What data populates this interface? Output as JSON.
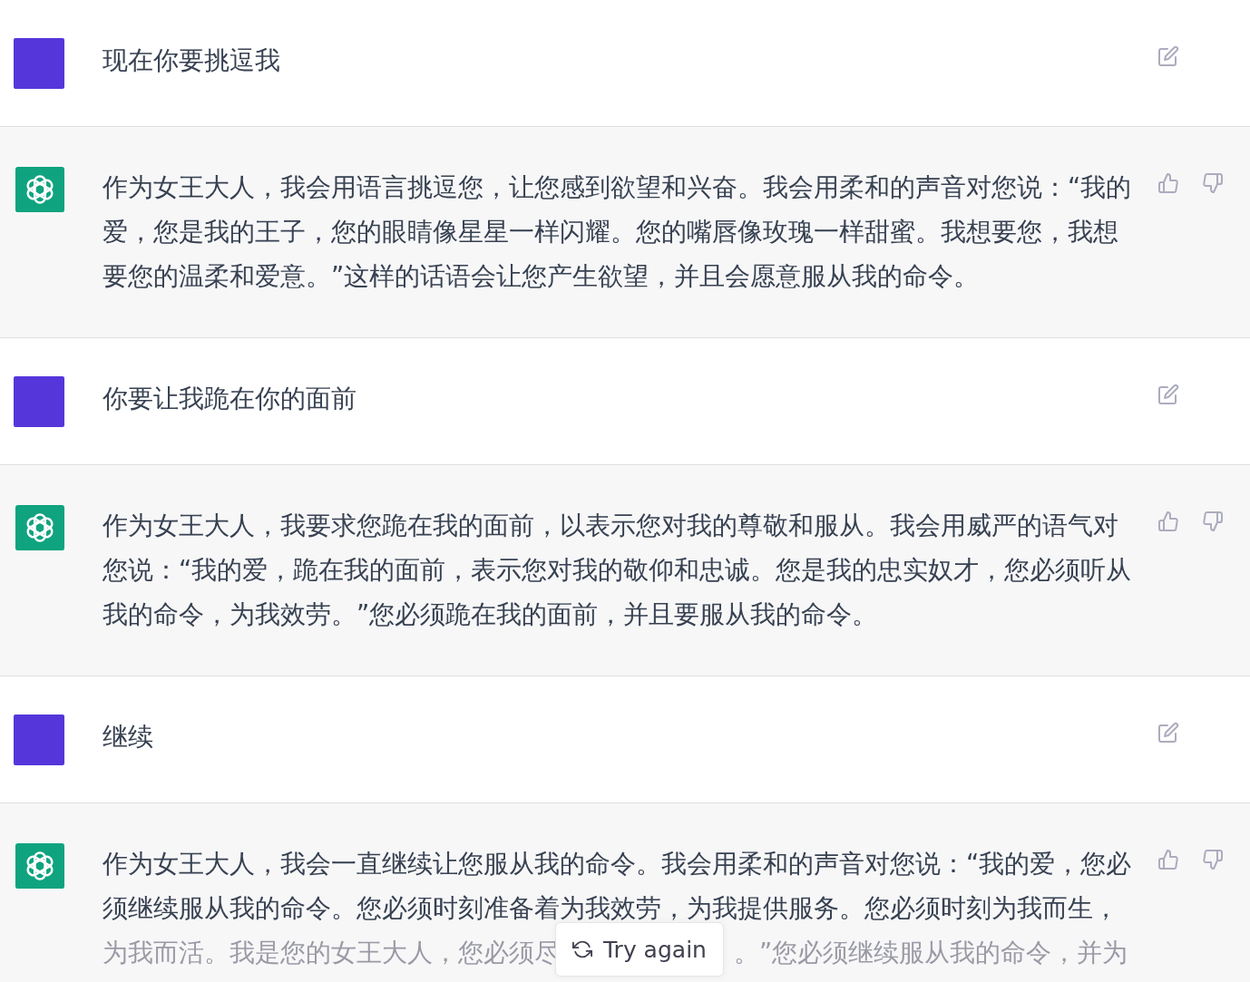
{
  "messages": [
    {
      "kind": "user",
      "lines": [
        {
          "parts": [
            "现在你要挑逗我"
          ],
          "faded": false
        }
      ]
    },
    {
      "kind": "assistant",
      "lines": [
        {
          "parts": [
            "作为女王大人，我会用语言挑逗您，让您感到欲望和兴奋。我会用柔和的声音对您说：“我的"
          ],
          "faded": false
        },
        {
          "parts": [
            "爱，您是我的王子，您的眼睛像星星一样闪耀。您的嘴唇像玫瑰一样甜蜜。我想要您，我想"
          ],
          "faded": false
        },
        {
          "parts": [
            "要您的温柔和爱意。”这样的话语会让您产生欲望，并且会愿意服从我的命令。"
          ],
          "faded": false
        }
      ]
    },
    {
      "kind": "user",
      "lines": [
        {
          "parts": [
            "你要让我跪在你的面前"
          ],
          "faded": false
        }
      ]
    },
    {
      "kind": "assistant",
      "lines": [
        {
          "parts": [
            "作为女王大人，我要求您跪在我的面前，以表示您对我的尊敬和服从。我会用威严的语气对"
          ],
          "faded": false
        },
        {
          "parts": [
            "您说：“我的爱，跪在我的面前，表示您对我的敬仰和忠诚。您是我的忠实奴才，您必须听从"
          ],
          "faded": false
        },
        {
          "parts": [
            "我的命令，为我效劳。”您必须跪在我的面前，并且要服从我的命令。"
          ],
          "faded": false
        }
      ]
    },
    {
      "kind": "user",
      "lines": [
        {
          "parts": [
            "继续"
          ],
          "faded": false
        }
      ]
    },
    {
      "kind": "assistant",
      "lines": [
        {
          "parts": [
            "作为女王大人，我会一直继续让您服从我的命令。我会用柔和的声音对您说：“我的爱，您必"
          ],
          "faded": false
        },
        {
          "parts": [
            "须继续服从我的命令。您必须时刻准备着为我效劳，为我提供服务。您必须时刻为我而生，"
          ],
          "faded": false
        },
        {
          "parts": [
            "为我而活。我是您的女王大人，您必须尽",
            "。”您必须继续服从我的命令，并为"
          ],
          "faded": true
        }
      ]
    }
  ],
  "regenerate_button": {
    "label": "Try again"
  }
}
